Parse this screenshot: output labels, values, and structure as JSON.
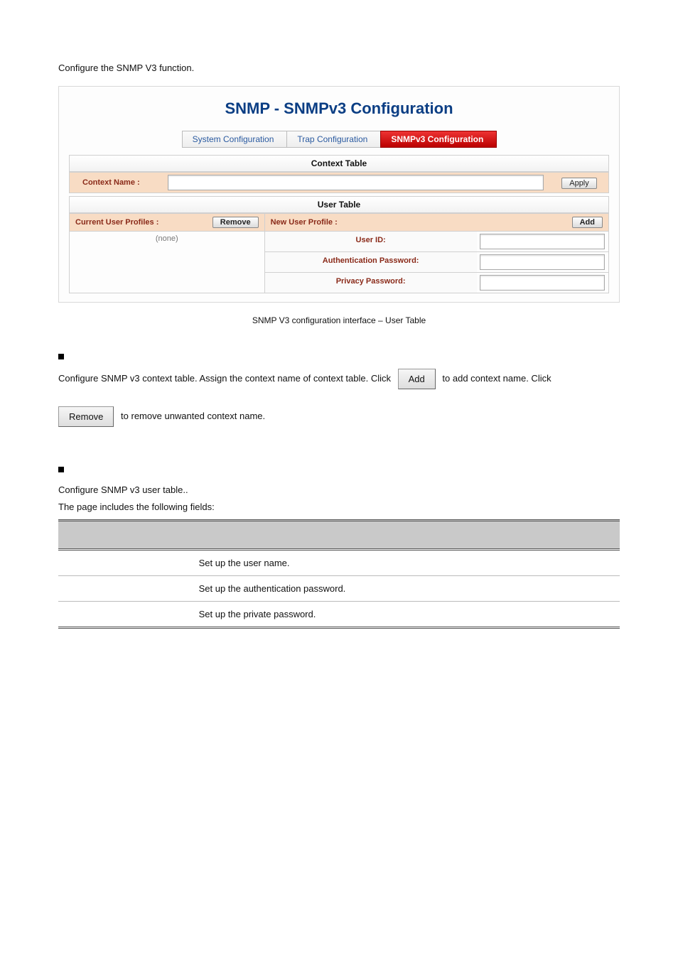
{
  "intro": "Configure the SNMP V3 function.",
  "shot": {
    "title": "SNMP - SNMPv3 Configuration",
    "tabs": {
      "sys": "System Configuration",
      "trap": "Trap Configuration",
      "v3": "SNMPv3 Configuration"
    },
    "contextTable": {
      "heading": "Context Table",
      "label": "Context Name :",
      "apply": "Apply"
    },
    "userTable": {
      "heading": "User Table",
      "left": {
        "label": "Current User Profiles :",
        "remove": "Remove",
        "none": "(none)"
      },
      "right": {
        "label": "New User Profile :",
        "add": "Add",
        "rows": {
          "uid": "User ID:",
          "auth": "Authentication Password:",
          "priv": "Privacy Password:"
        }
      }
    }
  },
  "caption": "SNMP V3 configuration interface – User Table",
  "sectionA": {
    "pre": "Configure SNMP v3 context table. Assign the context name of context table. Click",
    "addBtn": "Add",
    "mid": "to add context name. Click",
    "removeBtn": "Remove",
    "post": "to remove unwanted context name."
  },
  "sectionB": {
    "line1": "Configure SNMP v3 user table..",
    "line2": "The page includes the following fields:"
  },
  "table": {
    "rows": [
      {
        "k": "",
        "v": "Set up the user name."
      },
      {
        "k": "",
        "v": "Set up the authentication password."
      },
      {
        "k": "",
        "v": "Set up the private password."
      }
    ]
  }
}
